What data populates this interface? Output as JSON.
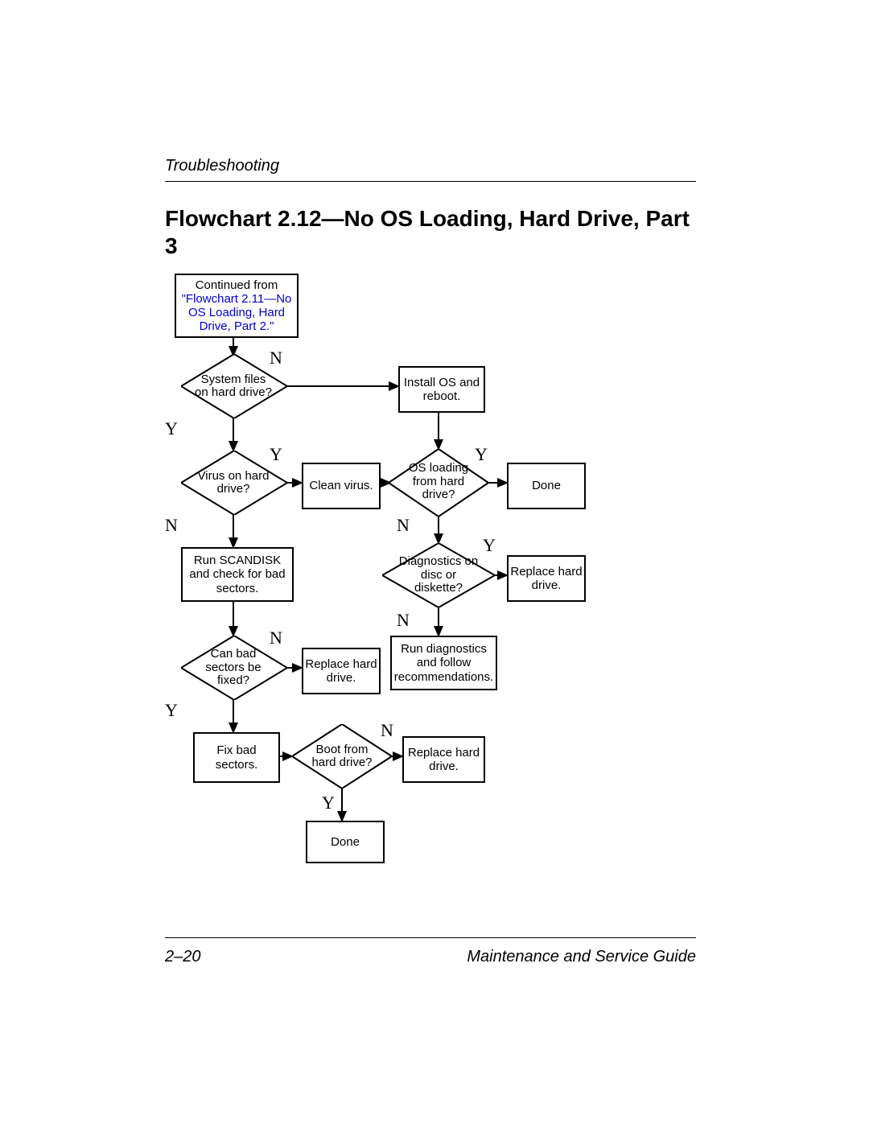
{
  "header": {
    "section": "Troubleshooting"
  },
  "title": "Flowchart 2.12—No OS Loading, Hard Drive, Part 3",
  "footer": {
    "pageNum": "2–20",
    "guide": "Maintenance and Service Guide"
  },
  "nodes": {
    "start": {
      "pre": "Continued from",
      "link": "\"Flowchart 2.11—No OS Loading, Hard Drive, Part 2.\""
    },
    "d1": "System files on hard drive?",
    "p_install": "Install OS and reboot.",
    "d2": "Virus on hard drive?",
    "p_clean": "Clean virus.",
    "d3": "OS loading from hard drive?",
    "p_done1": "Done",
    "p_scandisk": "Run SCANDISK and check for bad sectors.",
    "d4": "Diagnostics on disc or diskette?",
    "p_replace1": "Replace hard drive.",
    "d5": "Can bad sectors be fixed?",
    "p_replace2": "Replace hard drive.",
    "p_rundiag": "Run diagnostics and follow recommendations.",
    "p_fixbad": "Fix bad sectors.",
    "d6": "Boot from hard drive?",
    "p_replace3": "Replace hard drive.",
    "p_done2": "Done"
  },
  "labels": {
    "Y": "Y",
    "N": "N"
  }
}
